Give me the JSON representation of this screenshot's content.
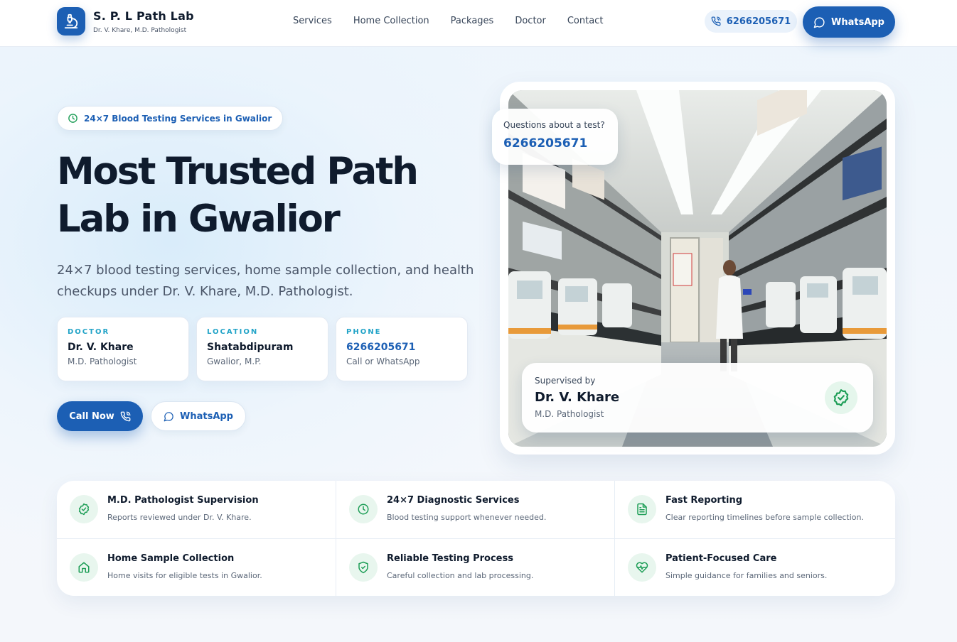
{
  "nav": {
    "brand_name": "S. P. L Path Lab",
    "brand_sub": "Dr. V. Khare, M.D. Pathologist",
    "links": [
      "Services",
      "Home Collection",
      "Packages",
      "Doctor",
      "Contact"
    ],
    "phone": "6266205671",
    "whatsapp_label": "WhatsApp"
  },
  "hero": {
    "badge": "24×7 Blood Testing Services in Gwalior",
    "title_line1": "Most Trusted Path",
    "title_line2": "Lab in Gwalior",
    "subtitle": "24×7 blood testing services, home sample collection, and health checkups under Dr. V. Khare, M.D. Pathologist.",
    "info_cards": [
      {
        "label": "DOCTOR",
        "value": "Dr. V. Khare",
        "note": "M.D. Pathologist"
      },
      {
        "label": "LOCATION",
        "value": "Shatabdipuram",
        "note": "Gwalior, M.P."
      },
      {
        "label": "PHONE",
        "value": "6266205671",
        "note": "Call or WhatsApp"
      }
    ],
    "call_label": "Call Now",
    "whatsapp_label": "WhatsApp"
  },
  "photo": {
    "question_text": "Questions about a test?",
    "question_phone": "6266205671",
    "supervised_label": "Supervised by",
    "supervisor_name": "Dr. V. Khare",
    "supervisor_title": "M.D. Pathologist"
  },
  "features": [
    {
      "icon": "shield-check-icon",
      "title": "M.D. Pathologist Supervision",
      "desc": "Reports reviewed under Dr. V. Khare."
    },
    {
      "icon": "clock-icon",
      "title": "24×7 Diagnostic Services",
      "desc": "Blood testing support whenever needed."
    },
    {
      "icon": "document-icon",
      "title": "Fast Reporting",
      "desc": "Clear reporting timelines before sample collection."
    },
    {
      "icon": "home-icon",
      "title": "Home Sample Collection",
      "desc": "Home visits for eligible tests in Gwalior."
    },
    {
      "icon": "shield-icon",
      "title": "Reliable Testing Process",
      "desc": "Careful collection and lab processing."
    },
    {
      "icon": "heart-pulse-icon",
      "title": "Patient-Focused Care",
      "desc": "Simple guidance for families and seniors."
    }
  ],
  "colors": {
    "primary": "#1c5fb4",
    "accent_cyan": "#21a3c7",
    "accent_green": "#1e9e57",
    "text_dark": "#0f1b2d"
  }
}
